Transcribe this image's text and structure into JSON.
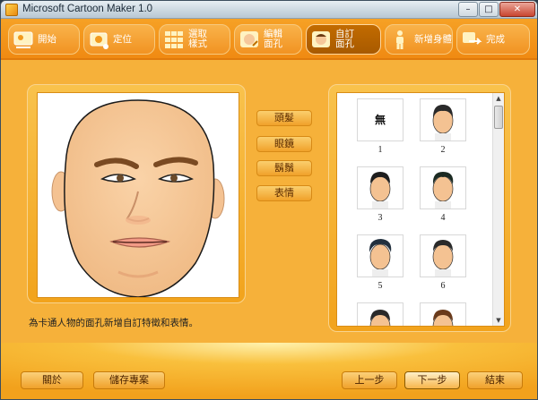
{
  "window": {
    "title": "Microsoft Cartoon Maker 1.0",
    "min": "–",
    "max": "□",
    "close": "✕"
  },
  "steps": [
    {
      "id": "start",
      "label": "開始"
    },
    {
      "id": "position",
      "label": "定位"
    },
    {
      "id": "style",
      "label": "選取\n樣式"
    },
    {
      "id": "edit-face",
      "label": "編輯\n面孔"
    },
    {
      "id": "custom-face",
      "label": "自訂\n面孔",
      "active": true
    },
    {
      "id": "add-body",
      "label": "新增身體"
    },
    {
      "id": "finish",
      "label": "完成"
    }
  ],
  "feature_buttons": {
    "hair": "頭髮",
    "glasses": "眼鏡",
    "beard": "鬍鬚",
    "expression": "表情"
  },
  "gallery": {
    "none_label": "無",
    "items": [
      "1",
      "2",
      "3",
      "4",
      "5",
      "6"
    ]
  },
  "description": "為卡通人物的面孔新增自訂特徵和表情。",
  "footer": {
    "about": "關於",
    "save_project": "儲存專案",
    "prev": "上一步",
    "next": "下一步",
    "finish": "結束"
  },
  "colors": {
    "accent": "#f29a1e",
    "active_step": "#b35f00",
    "skin": "#f6c89a"
  }
}
